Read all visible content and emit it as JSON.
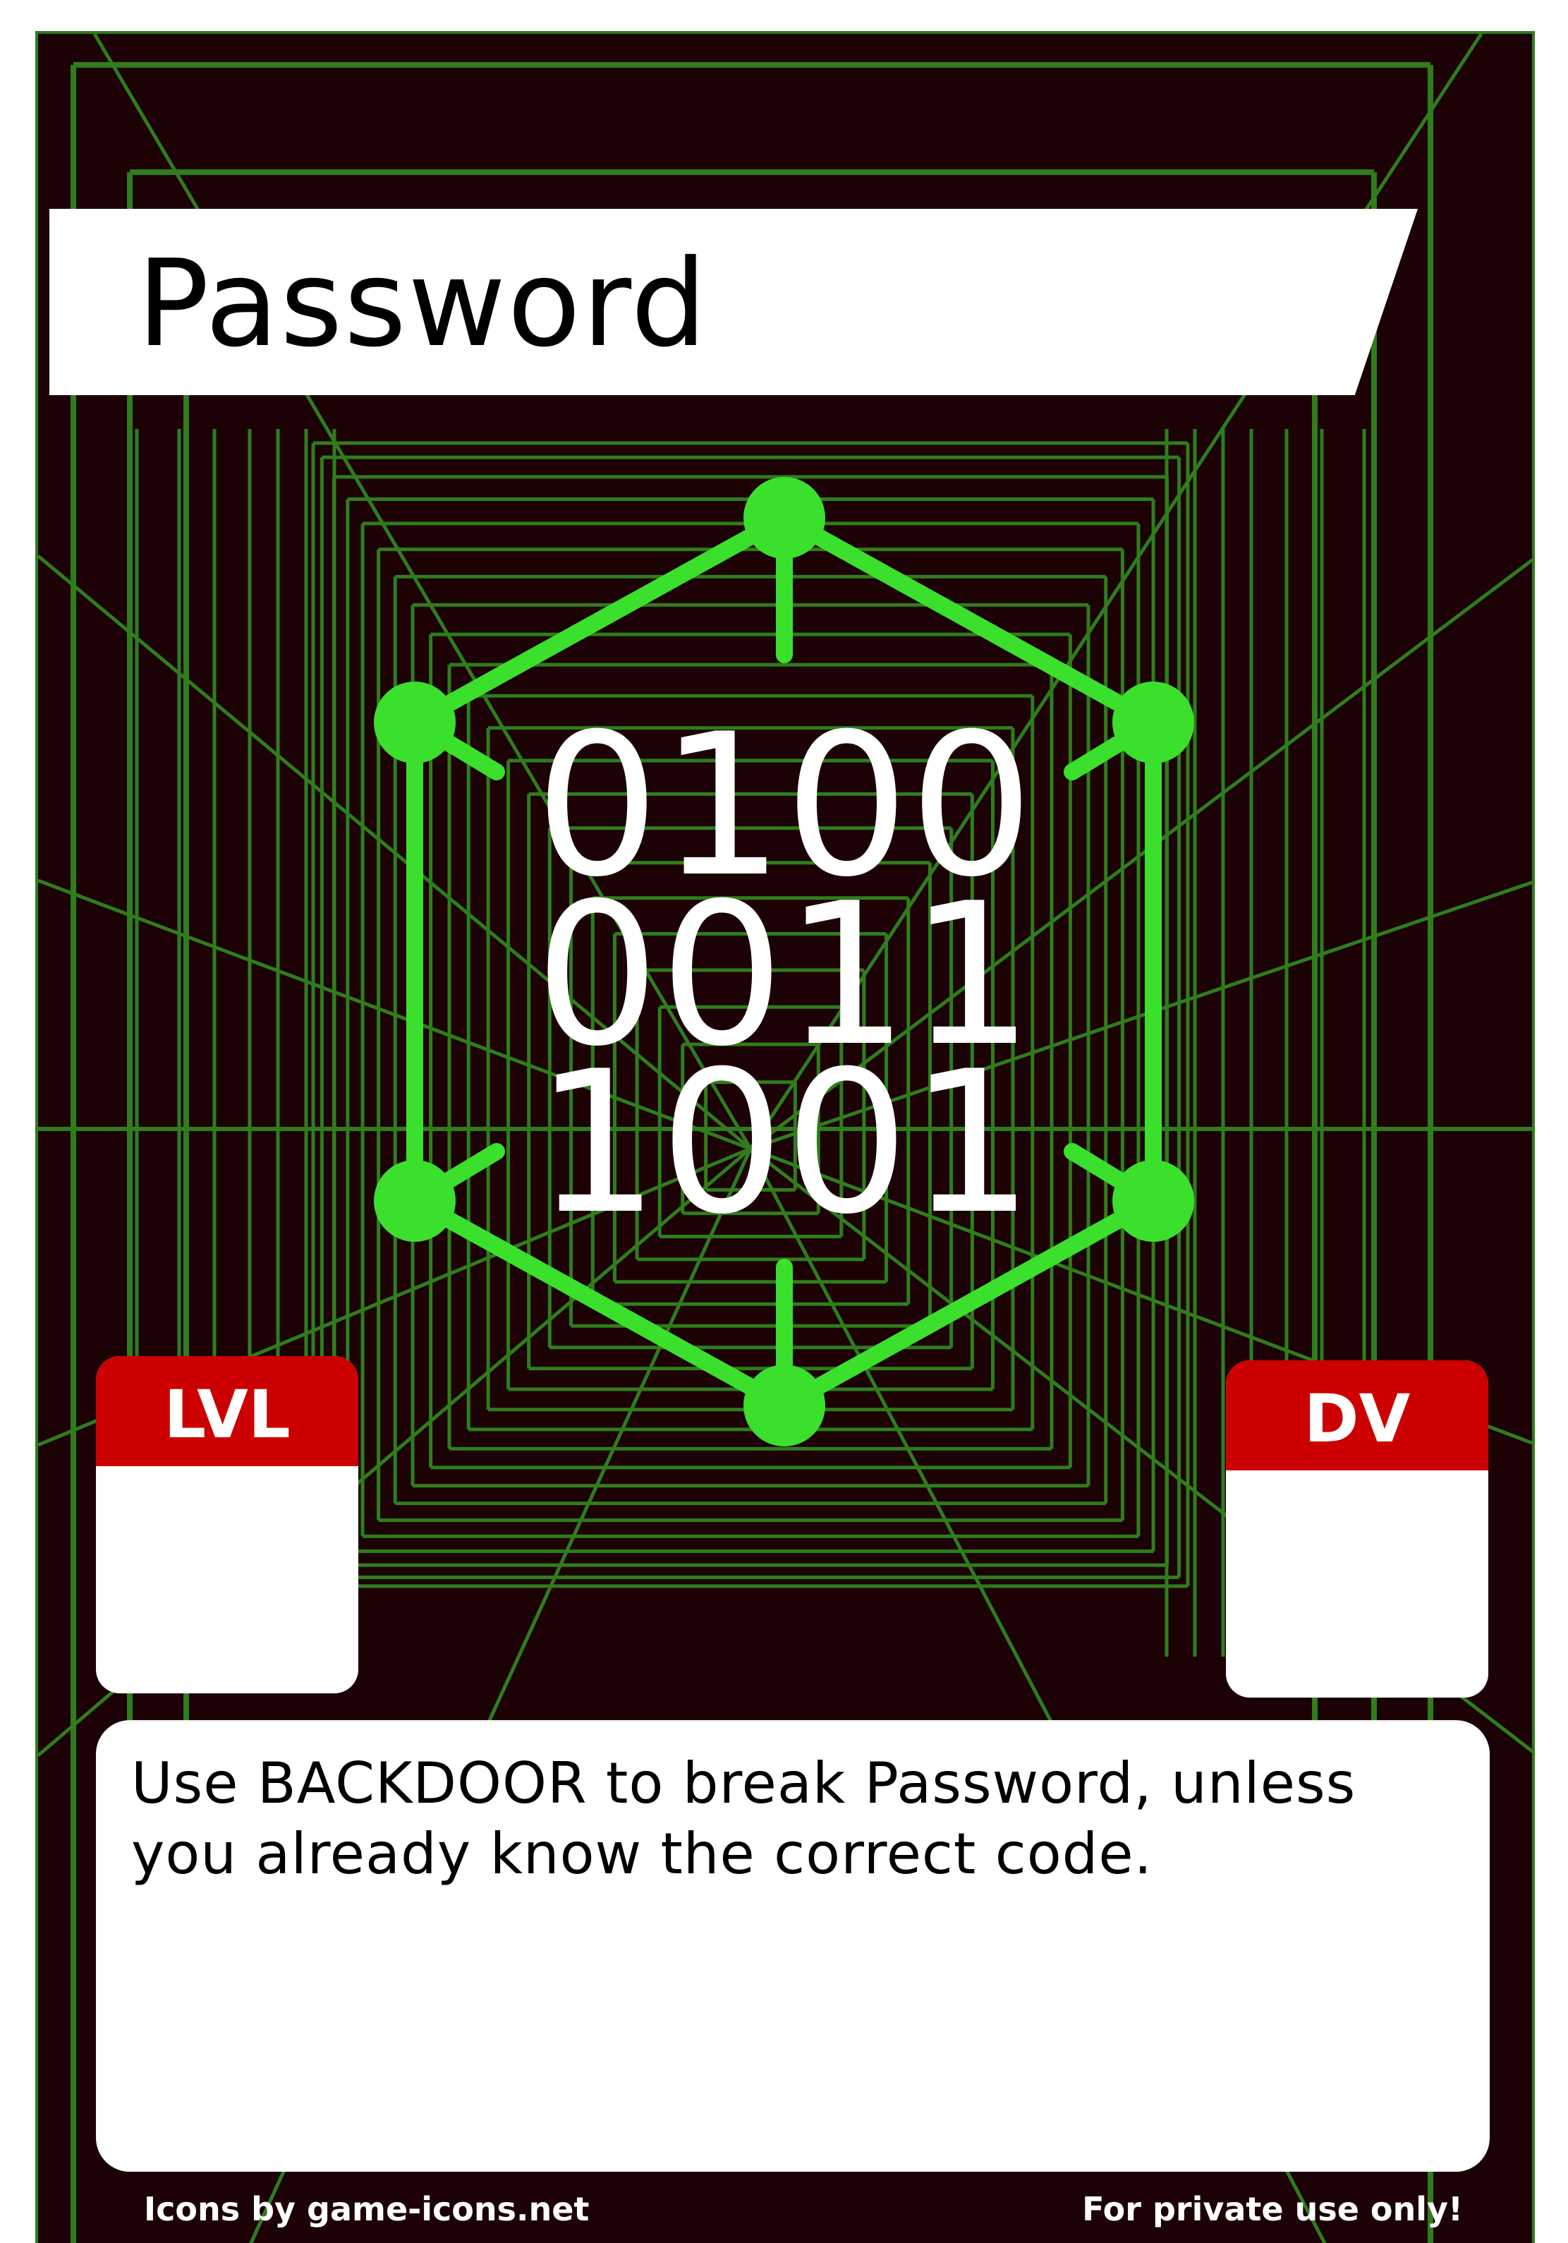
{
  "card": {
    "title": "Password",
    "emblem": {
      "icon": "binary-hexagon-icon",
      "lines": [
        "0100",
        "0011",
        "1001"
      ],
      "color": "#3be02d"
    },
    "stats": {
      "lvl_label": "LVL",
      "lvl_value": "",
      "dv_label": "DV",
      "dv_value": ""
    },
    "rules_text": "Use BACKDOOR to break Password, unless you already know the correct code.",
    "footer": {
      "credit": "Icons by game-icons.net",
      "notice": "For private use only!"
    }
  },
  "colors": {
    "background": "#1c0205",
    "grid": "#2f7d1b",
    "header_red": "#cc0000",
    "panel": "#ffffff"
  }
}
